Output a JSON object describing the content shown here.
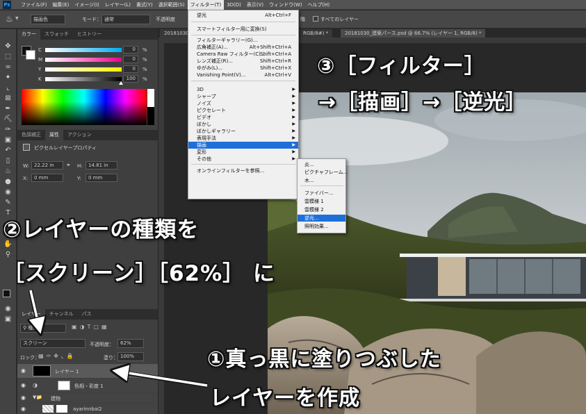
{
  "menubar": {
    "logo": "Ps",
    "items": [
      "ファイル(F)",
      "編集(E)",
      "イメージ(I)",
      "レイヤー(L)",
      "書式(Y)",
      "選択範囲(S)",
      "フィルター(T)",
      "3D(D)",
      "表示(V)",
      "ウィンドウ(W)",
      "ヘルプ(H)"
    ],
    "active_index": 6
  },
  "optionsbar": {
    "mode_value": "描画色",
    "mode_label": "モード：",
    "mode_select": "通常",
    "opacity_label": "不透明度",
    "antialias_label": "階",
    "all_layers_label": "すべてのレイヤー"
  },
  "doc_tabs": [
    "20181030",
    "RGB/8#) *",
    "20181030_建築パース.psd @ 66.7% (レイヤー 1, RGB/8) *"
  ],
  "color_panel": {
    "tabs": [
      "カラー",
      "スウォッチ",
      "ヒストリー"
    ],
    "sliders": [
      {
        "label": "C",
        "value": "0",
        "unit": "%"
      },
      {
        "label": "M",
        "value": "0",
        "unit": "%"
      },
      {
        "label": "Y",
        "value": "0",
        "unit": "%"
      },
      {
        "label": "K",
        "value": "100",
        "unit": "%"
      }
    ]
  },
  "props_panel": {
    "tabs": [
      "色調補正",
      "属性",
      "アクション"
    ],
    "title": "ピクセルレイヤープロパティ",
    "w_label": "W:",
    "w_value": "22.22 in",
    "h_label": "H:",
    "h_value": "14.81 in",
    "x_label": "X:",
    "x_value": "0 mm",
    "y_label": "Y:",
    "y_value": "0 mm"
  },
  "layers_panel": {
    "tabs": [
      "レイヤー",
      "チャンネル",
      "パス"
    ],
    "kind_label": "種類",
    "blend_mode": "スクリーン",
    "opacity_label": "不透明度：",
    "opacity_value": "62%",
    "lock_label": "ロック：",
    "fill_label": "塗り：",
    "fill_value": "100%",
    "layers": [
      {
        "name": "レイヤー 1"
      },
      {
        "name": "色相・彩度 1"
      },
      {
        "name": "建物"
      },
      {
        "name": "ayarinnbai2"
      }
    ]
  },
  "filter_menu": {
    "items": [
      {
        "label": "逆光",
        "shortcut": "Alt+Ctrl+F"
      },
      {
        "label": "スマートフィルター用に変換(S)",
        "shortcut": ""
      },
      {
        "label": "フィルターギャラリー(G)...",
        "shortcut": ""
      },
      {
        "label": "広角補正(A)...",
        "shortcut": "Alt+Shift+Ctrl+A"
      },
      {
        "label": "Camera Raw フィルター(C)...",
        "shortcut": "Shift+Ctrl+A"
      },
      {
        "label": "レンズ補正(R)...",
        "shortcut": "Shift+Ctrl+R"
      },
      {
        "label": "ゆがみ(L)...",
        "shortcut": "Shift+Ctrl+X"
      },
      {
        "label": "Vanishing Point(V)...",
        "shortcut": "Alt+Ctrl+V"
      },
      {
        "label": "3D",
        "shortcut": ""
      },
      {
        "label": "シャープ",
        "shortcut": ""
      },
      {
        "label": "ノイズ",
        "shortcut": ""
      },
      {
        "label": "ピクセレート",
        "shortcut": ""
      },
      {
        "label": "ビデオ",
        "shortcut": ""
      },
      {
        "label": "ぼかし",
        "shortcut": ""
      },
      {
        "label": "ぼかしギャラリー",
        "shortcut": ""
      },
      {
        "label": "表現手法",
        "shortcut": ""
      },
      {
        "label": "描画",
        "shortcut": ""
      },
      {
        "label": "変形",
        "shortcut": ""
      },
      {
        "label": "その他",
        "shortcut": ""
      },
      {
        "label": "オンラインフィルターを参照...",
        "shortcut": ""
      }
    ]
  },
  "render_submenu": {
    "items": [
      "炎...",
      "ピクチャフレーム...",
      "木...",
      "ファイバー...",
      "雲模様 1",
      "雲模様 2",
      "逆光...",
      "照明効果..."
    ]
  },
  "annotations": {
    "step3_line1": "③［フィルター］",
    "step3_line2": "→［描画］→［逆光］",
    "step2_line1": "②レイヤーの種類を",
    "step2_line2": "［スクリーン］［62%］ に",
    "step1_line1": "①真っ黒に塗りつぶした",
    "step1_line2": "レイヤーを作成"
  }
}
